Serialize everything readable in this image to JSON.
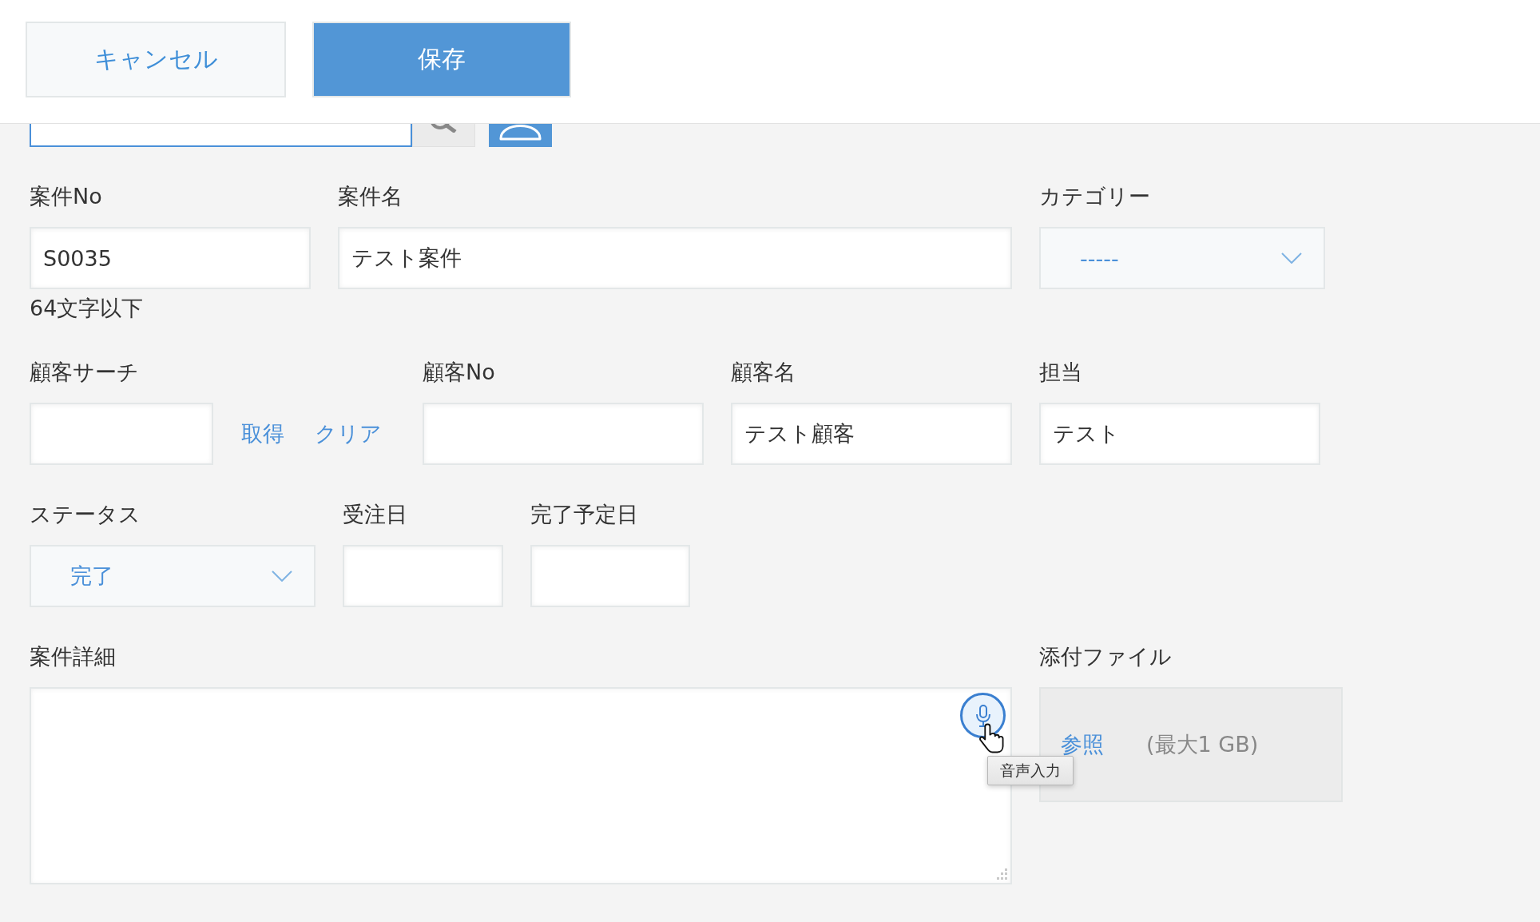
{
  "header": {
    "buttons": [
      {
        "kind": "secondary",
        "label": "キャンセル"
      },
      {
        "kind": "primary",
        "label": "保存"
      }
    ]
  },
  "lookup_bar": {
    "search_field": {
      "focused": true
    }
  },
  "rows": [
    {
      "fields": [
        {
          "kind": "text",
          "label": "案件No",
          "value": "S0035",
          "hint": "64文字以下"
        },
        {
          "kind": "text",
          "label": "案件名",
          "value": "テスト案件"
        },
        {
          "kind": "select",
          "label": "カテゴリー",
          "value": "-----"
        }
      ]
    },
    {
      "fields": [
        {
          "kind": "lookup",
          "label": "顧客サーチ",
          "actions": [
            "取得",
            "クリア"
          ]
        },
        {
          "kind": "text",
          "label": "顧客No"
        },
        {
          "kind": "text",
          "label": "顧客名",
          "value": "テスト顧客"
        },
        {
          "kind": "text",
          "label": "担当",
          "value": "テスト"
        }
      ]
    },
    {
      "fields": [
        {
          "kind": "select",
          "label": "ステータス",
          "value": "完了"
        },
        {
          "kind": "date",
          "label": "受注日"
        },
        {
          "kind": "date",
          "label": "完了予定日"
        }
      ]
    },
    {
      "fields": [
        {
          "kind": "textarea",
          "label": "案件詳細",
          "voice_input": {
            "tooltip": "音声入力"
          }
        },
        {
          "kind": "file",
          "label": "添付ファイル",
          "browse": "参照",
          "limit": "(最大1 GB)"
        }
      ]
    }
  ]
}
